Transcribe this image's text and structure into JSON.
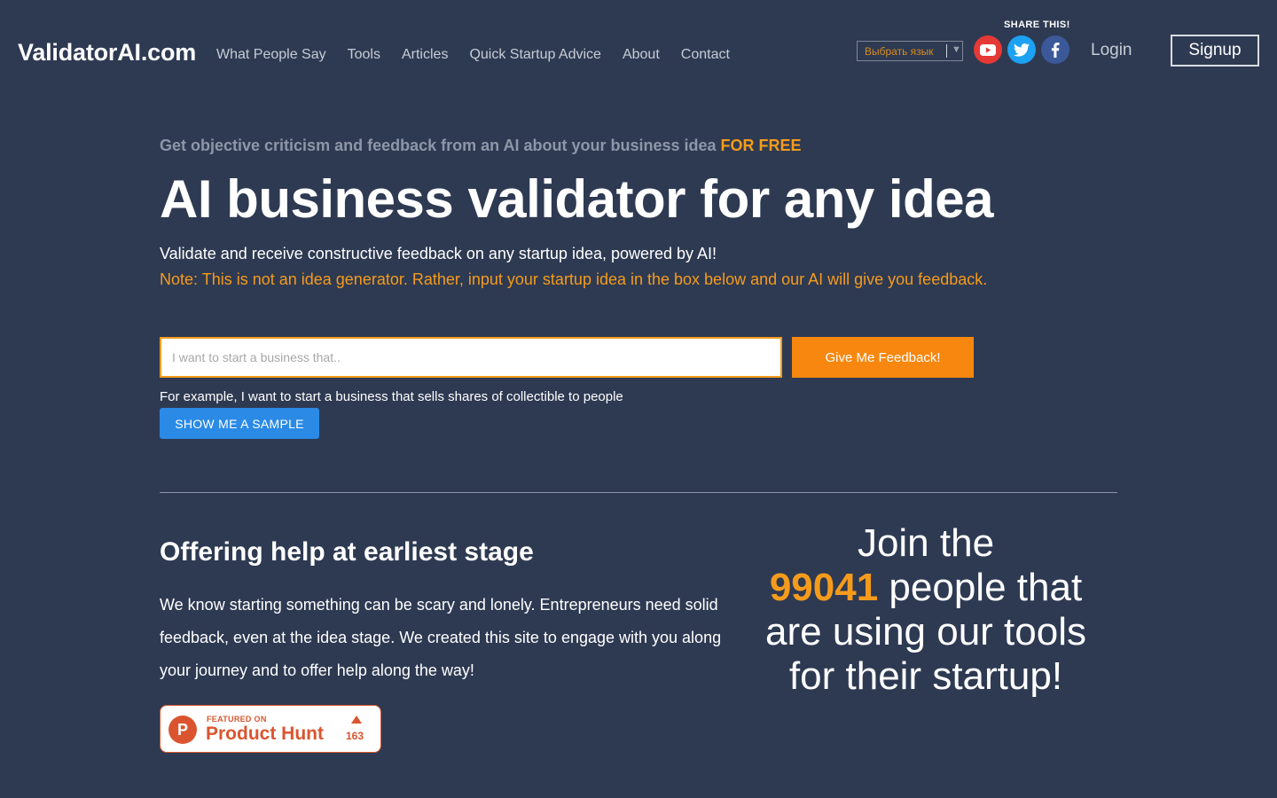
{
  "header": {
    "brand": "ValidatorAI.com",
    "nav": [
      "What People Say",
      "Tools",
      "Articles",
      "Quick Startup Advice",
      "About",
      "Contact"
    ],
    "share_label": "SHARE THIS!",
    "language_select": "Выбрать язык",
    "social_icons": [
      "youtube-icon",
      "twitter-icon",
      "facebook-icon"
    ],
    "login_label": "Login",
    "signup_label": "Signup"
  },
  "hero": {
    "eyebrow": "Get objective criticism and feedback from an AI about your business idea",
    "eyebrow_highlight": "FOR FREE",
    "title": "AI business validator for any idea",
    "subtitle": "Validate and receive constructive feedback on any startup idea, powered by AI!",
    "note": "Note: This is not an idea generator. Rather, input your startup idea in the box below and our AI will give you feedback.",
    "input_placeholder": "I want to start a business that..",
    "submit_label": "Give Me Feedback!",
    "example": "For example, I want to start a business that sells shares of collectible to people",
    "sample_label": "SHOW ME A SAMPLE"
  },
  "section": {
    "title": "Offering help at earliest stage",
    "body": "We know starting something can be scary and lonely. Entrepreneurs need solid feedback, even at the idea stage. We created this site to engage with you along your journey and to offer help along the way!"
  },
  "product_hunt": {
    "featured": "FEATURED ON",
    "name": "Product Hunt",
    "logo_letter": "P",
    "upvotes": "163"
  },
  "join": {
    "prefix": "Join the",
    "count": "99041",
    "suffix": "people that are using our tools for their startup!"
  },
  "colors": {
    "background": "#2e3a52",
    "accent": "#f59b1c",
    "button_orange": "#f7870f",
    "button_blue": "#2a8ae6",
    "product_hunt": "#da552f"
  }
}
